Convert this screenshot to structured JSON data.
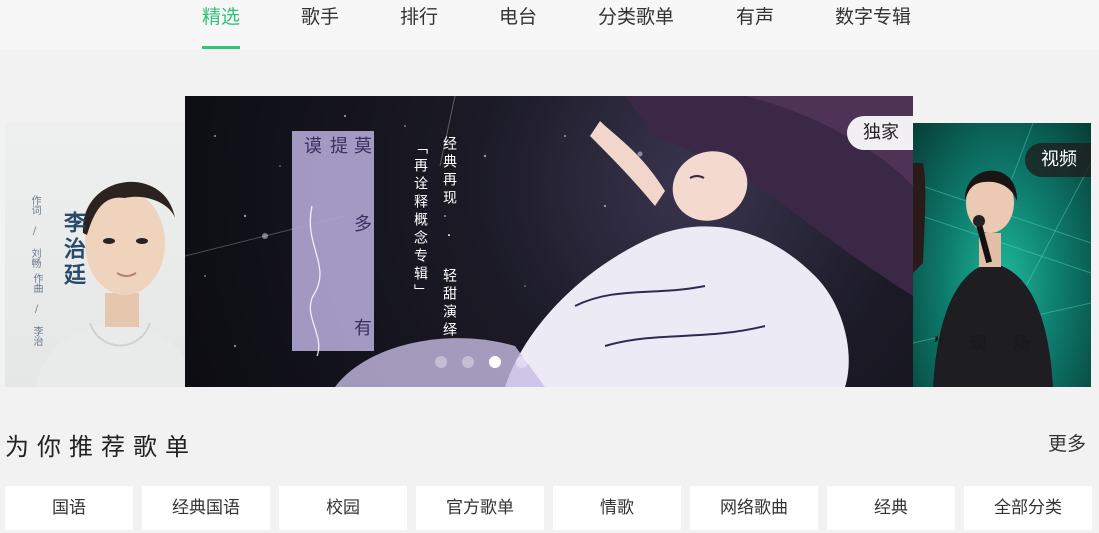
{
  "nav": {
    "items": [
      {
        "label": "精选",
        "active": true
      },
      {
        "label": "歌手",
        "active": false
      },
      {
        "label": "排行",
        "active": false
      },
      {
        "label": "电台",
        "active": false
      },
      {
        "label": "分类歌单",
        "active": false
      },
      {
        "label": "有声",
        "active": false
      },
      {
        "label": "数字专辑",
        "active": false
      }
    ]
  },
  "colors": {
    "accent": "#31c27c",
    "page_bg": "#f2f2f2",
    "nav_bg": "#f7f7f7"
  },
  "banner": {
    "left": {
      "artist": "李治廷",
      "credit_1": "作词 / 刘畅",
      "credit_2": "作曲 / 李治"
    },
    "main": {
      "tag": "独家",
      "title_vertical_1": "谟",
      "title_vertical_2": "提",
      "title_vertical_3": "莫",
      "subtitle_1": "经典再现 · 轻甜演绎",
      "subtitle_2": "「再诠释概念专辑」",
      "subtitle_3": "多",
      "subtitle_4": "有"
    },
    "right": {
      "tag": "视频",
      "caption": "” 现 场"
    },
    "dots_count": 4,
    "active_dot": 2
  },
  "section": {
    "title": "为你推荐歌单",
    "more_label": "更多"
  },
  "categories": [
    "国语",
    "经典国语",
    "校园",
    "官方歌单",
    "情歌",
    "网络歌曲",
    "经典",
    "全部分类"
  ]
}
